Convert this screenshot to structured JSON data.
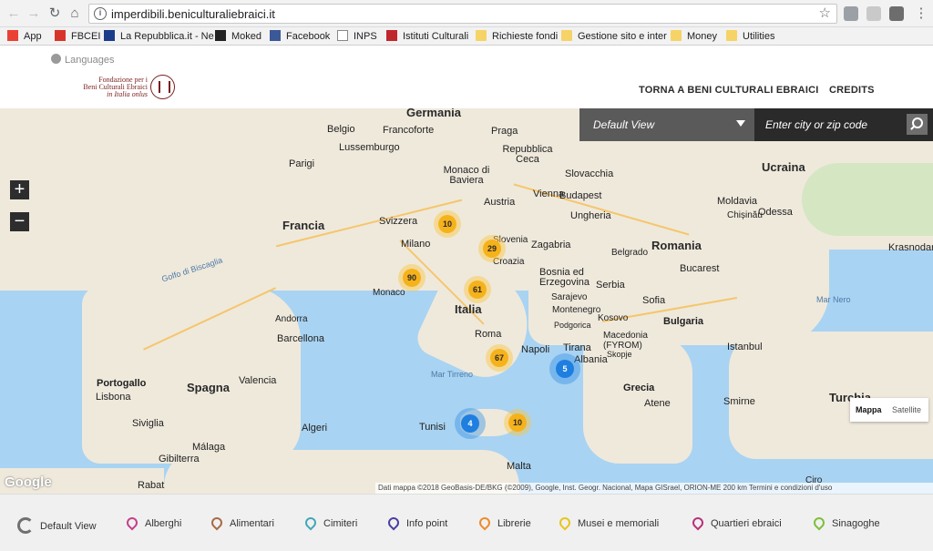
{
  "browser": {
    "url": "imperdibili.beniculturaliebraici.it",
    "bookmarks": [
      "App",
      "FBCEI",
      "La Repubblica.it - Ne",
      "Moked",
      "Facebook",
      "INPS",
      "Istituti Culturali",
      "Richieste fondi",
      "Gestione sito e inter",
      "Money",
      "Utilities"
    ]
  },
  "header": {
    "languages_label": "Languages",
    "logo_lines": [
      "Fondazione per i",
      "Beni Culturali Ebraici",
      "in Italia onlus"
    ],
    "nav": [
      "TORNA A BENI CULTURALI EBRAICI",
      "CREDITS"
    ]
  },
  "map_controls": {
    "view_select_value": "Default View",
    "city_search_placeholder": "Enter city or zip code",
    "zoom_in": "+",
    "zoom_out": "−",
    "map_types": [
      "Mappa",
      "Satellite"
    ],
    "google_logo": "Google",
    "attribution": "Dati mappa ©2018 GeoBasis-DE/BKG (©2009), Google, Inst. Geogr. Nacional, Mapa GISrael, ORION-ME    200 km          Termini e condizioni d'uso"
  },
  "map_labels": {
    "countries": [
      "Germania",
      "Francia",
      "Italia",
      "Spagna",
      "Portogallo",
      "Romania",
      "Ucraina",
      "Bulgaria",
      "Grecia",
      "Turchia",
      "Slovacchia",
      "Austria",
      "Svizzera",
      "Ungheria",
      "Serbia",
      "Albania",
      "Moldavia",
      "Repubblica Ceca",
      "Bosnia ed Erzegovina",
      "Montenegro",
      "Kosovo",
      "Macedonia (FYROM)",
      "Slovenia",
      "Croazia"
    ],
    "cities": [
      "Belgio",
      "Francoforte",
      "Praga",
      "Lussemburgo",
      "Parigi",
      "Monaco di Baviera",
      "Vienna",
      "Budapest",
      "Milano",
      "Zagabria",
      "Belgrado",
      "Bucarest",
      "Monaco",
      "Andorra",
      "Barcellona",
      "Roma",
      "Napoli",
      "Sofia",
      "Tirana",
      "Valencia",
      "Lisbona",
      "Siviglia",
      "Málaga",
      "Gibilterra",
      "Rabat",
      "Algeri",
      "Tunisi",
      "Malta",
      "Atene",
      "Istanbul",
      "Smirne",
      "Chișinău",
      "Odessa",
      "Krasnodar",
      "Sarajevo",
      "Podgorica",
      "Skopje",
      "Ciro"
    ],
    "seas": [
      "Golfo di Biscaglia",
      "Mar Tirreno",
      "Mar Nero"
    ]
  },
  "clusters": [
    {
      "count": "10",
      "color": "#f6b21b"
    },
    {
      "count": "29",
      "color": "#f6b21b"
    },
    {
      "count": "90",
      "color": "#f6b21b"
    },
    {
      "count": "61",
      "color": "#f6b21b"
    },
    {
      "count": "67",
      "color": "#f6b21b"
    },
    {
      "count": "5",
      "color": "#1f7fe0"
    },
    {
      "count": "4",
      "color": "#1f7fe0"
    },
    {
      "count": "10",
      "color": "#f6b21b"
    }
  ],
  "legend": [
    {
      "label": "Default View",
      "icon": "reset-view-icon",
      "color": "#707070"
    },
    {
      "label": "Alberghi",
      "icon": "hotel-pin-icon",
      "color": "#c2408a"
    },
    {
      "label": "Alimentari",
      "icon": "food-pin-icon",
      "color": "#a86a46"
    },
    {
      "label": "Cimiteri",
      "icon": "cemetery-pin-icon",
      "color": "#3fa8b8"
    },
    {
      "label": "Info point",
      "icon": "info-pin-icon",
      "color": "#4a3ea0"
    },
    {
      "label": "Librerie",
      "icon": "bookstore-pin-icon",
      "color": "#ef8a2a"
    },
    {
      "label": "Musei e memoriali",
      "icon": "museum-pin-icon",
      "color": "#e8c41a"
    },
    {
      "label": "Quartieri ebraici",
      "icon": "quarter-pin-icon",
      "color": "#b8307a"
    },
    {
      "label": "Sinagoghe",
      "icon": "synagogue-pin-icon",
      "color": "#7cbf3a"
    }
  ]
}
